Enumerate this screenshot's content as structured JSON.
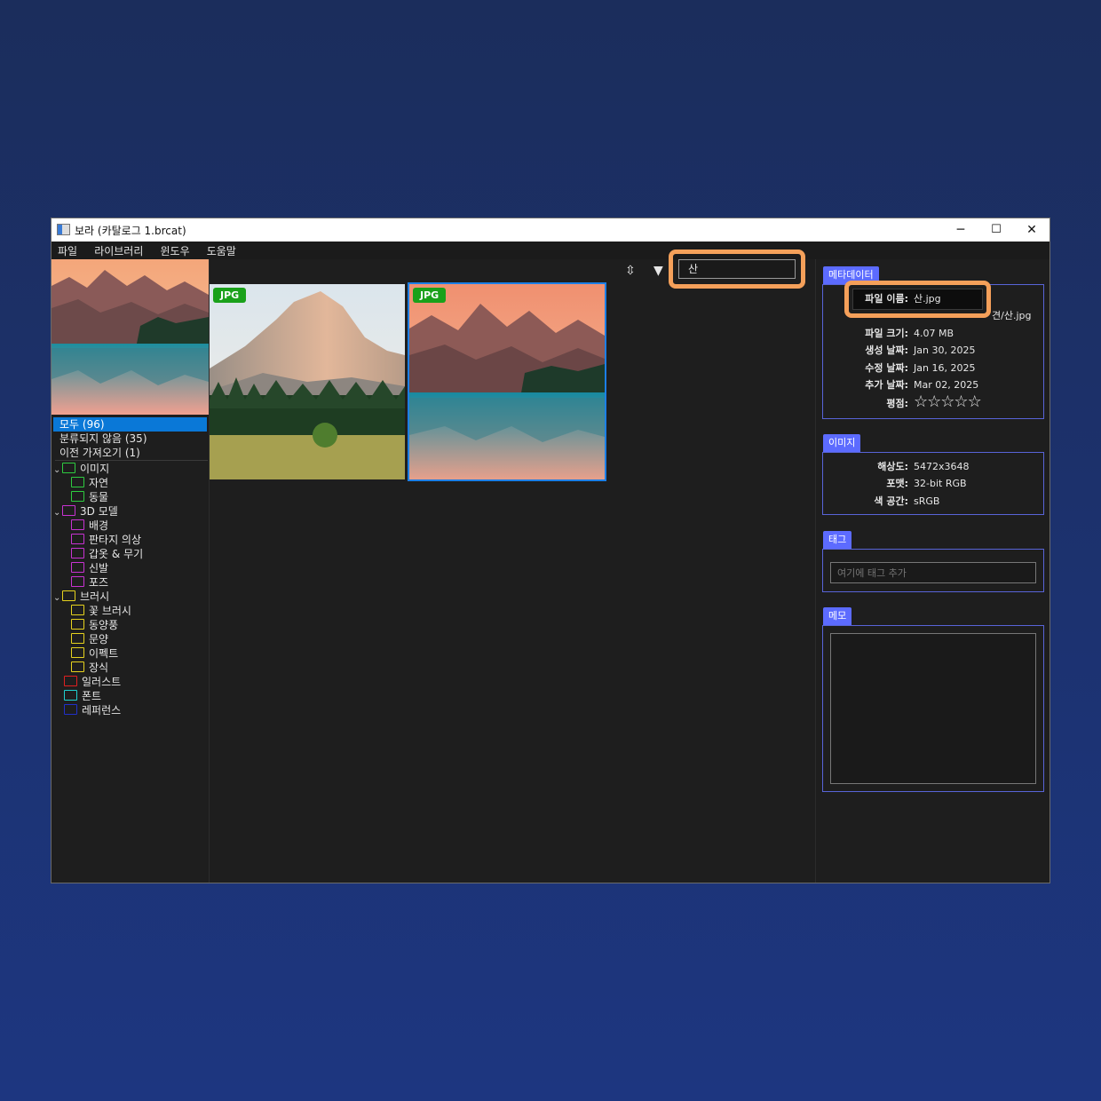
{
  "window": {
    "title": "보라 (카탈로그 1.brcat)",
    "controls": {
      "minimize": "─",
      "maximize": "☐",
      "close": "✕"
    }
  },
  "menubar": {
    "items": [
      "파일",
      "라이브러리",
      "윈도우",
      "도움말"
    ]
  },
  "library": {
    "items": [
      {
        "label": "모두 (96)",
        "selected": true
      },
      {
        "label": "분류되지 않음 (35)",
        "selected": false
      },
      {
        "label": "이전 가져오기 (1)",
        "selected": false
      }
    ]
  },
  "tree": {
    "groups": [
      {
        "label": "이미지",
        "color": "#2ecc40",
        "children": [
          "자연",
          "동물"
        ]
      },
      {
        "label": "3D 모델",
        "color": "#c832d2",
        "children": [
          "배경",
          "판타지 의상",
          "갑옷 & 무기",
          "신발",
          "포즈"
        ]
      },
      {
        "label": "브러시",
        "color": "#e6d21e",
        "children": [
          "꽃 브러시",
          "동양풍",
          "문양",
          "이펙트",
          "장식"
        ]
      }
    ],
    "leaves": [
      {
        "label": "일러스트",
        "color": "#e02020"
      },
      {
        "label": "폰트",
        "color": "#20d0d0"
      },
      {
        "label": "레퍼런스",
        "color": "#2030c8"
      }
    ]
  },
  "toolbar": {
    "sort_icon": "sort-icon",
    "filter_icon": "filter-icon",
    "search_value": "산"
  },
  "grid": {
    "items": [
      {
        "badge": "JPG",
        "selected": false
      },
      {
        "badge": "JPG",
        "selected": true
      }
    ]
  },
  "metadata": {
    "tab": "메타데이터",
    "filename_label": "파일 이름:",
    "filename_value": "산.jpg",
    "path_tail": "견/산.jpg",
    "rows": [
      {
        "k": "파일 크기:",
        "v": "4.07 MB"
      },
      {
        "k": "생성 날짜:",
        "v": "Jan 30, 2025"
      },
      {
        "k": "수정 날짜:",
        "v": "Jan 16, 2025"
      },
      {
        "k": "추가 날짜:",
        "v": "Mar 02, 2025"
      }
    ],
    "rating_label": "평점:",
    "rating": 0,
    "rating_max": 5
  },
  "image_info": {
    "tab": "이미지",
    "rows": [
      {
        "k": "해상도:",
        "v": "5472x3648"
      },
      {
        "k": "포맷:",
        "v": "32-bit RGB"
      },
      {
        "k": "색 공간:",
        "v": "sRGB"
      }
    ]
  },
  "tags": {
    "tab": "태그",
    "placeholder": "여기에 태그 추가"
  },
  "memo": {
    "tab": "메모"
  },
  "colors": {
    "accent": "#0a78d7",
    "highlight": "#f5a05a",
    "panel_header": "#5c6bff",
    "badge": "#1aa11a"
  }
}
